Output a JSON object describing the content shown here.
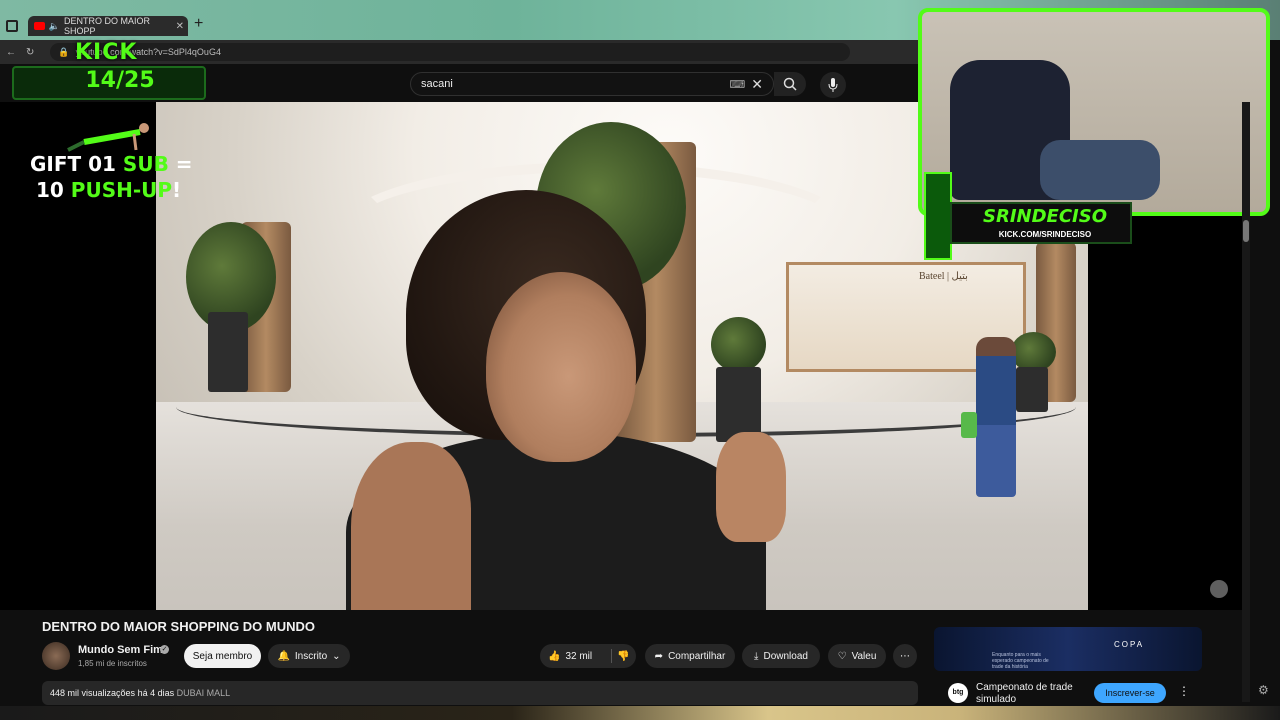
{
  "browser": {
    "tab_title": "DENTRO DO MAIOR SHOPP",
    "url": "youtube.com/watch?v=SdPl4qOuG4"
  },
  "youtube": {
    "search_value": "sacani"
  },
  "overlay": {
    "kick_logo": "KICK",
    "sub_counter": "14/25",
    "gift_line1_a": "GIFT 01 ",
    "gift_line1_b": "SUB",
    "gift_line1_c": " =",
    "gift_line2_a": "10 ",
    "gift_line2_b": "PUSH-UP",
    "gift_line2_c": "!",
    "streamer_name": "SRINDECISO",
    "streamer_url": "KICK.COM/SRINDECISO",
    "store_sign": "Bateel | بتيل"
  },
  "video": {
    "title": "DENTRO DO MAIOR SHOPPING DO MUNDO",
    "channel": "Mundo Sem Fim",
    "subscribers": "1,85 mi de inscritos",
    "join_label": "Seja membro",
    "subscribed_label": "Inscrito",
    "likes": "32 mil",
    "share_label": "Compartilhar",
    "download_label": "Download",
    "thanks_label": "Valeu",
    "views": "448 mil visualizações",
    "date": "há 4 dias",
    "tag": "DUBAI MALL"
  },
  "ad": {
    "brand": "COPA",
    "small_text": "Enquanto para o mais esperado campeonato de trade da história",
    "logo": "btg",
    "text": "Campeonato de trade simulado",
    "cta": "Inscrever-se"
  },
  "icons": [
    "window-icon",
    "youtube-icon",
    "speaker-icon",
    "close-icon",
    "plus-icon",
    "back-icon",
    "reload-icon",
    "lock-icon",
    "keyboard-icon",
    "clear-icon",
    "search-icon",
    "mic-icon",
    "verified-icon",
    "bell-icon",
    "chevron-down-icon",
    "like-icon",
    "dislike-icon",
    "share-icon",
    "download-icon",
    "thanks-icon",
    "more-icon",
    "settings-icon"
  ],
  "colors": {
    "kick_green": "#53fc18",
    "youtube_red": "#ff0000",
    "subscribe_blue": "#3ea6ff"
  }
}
